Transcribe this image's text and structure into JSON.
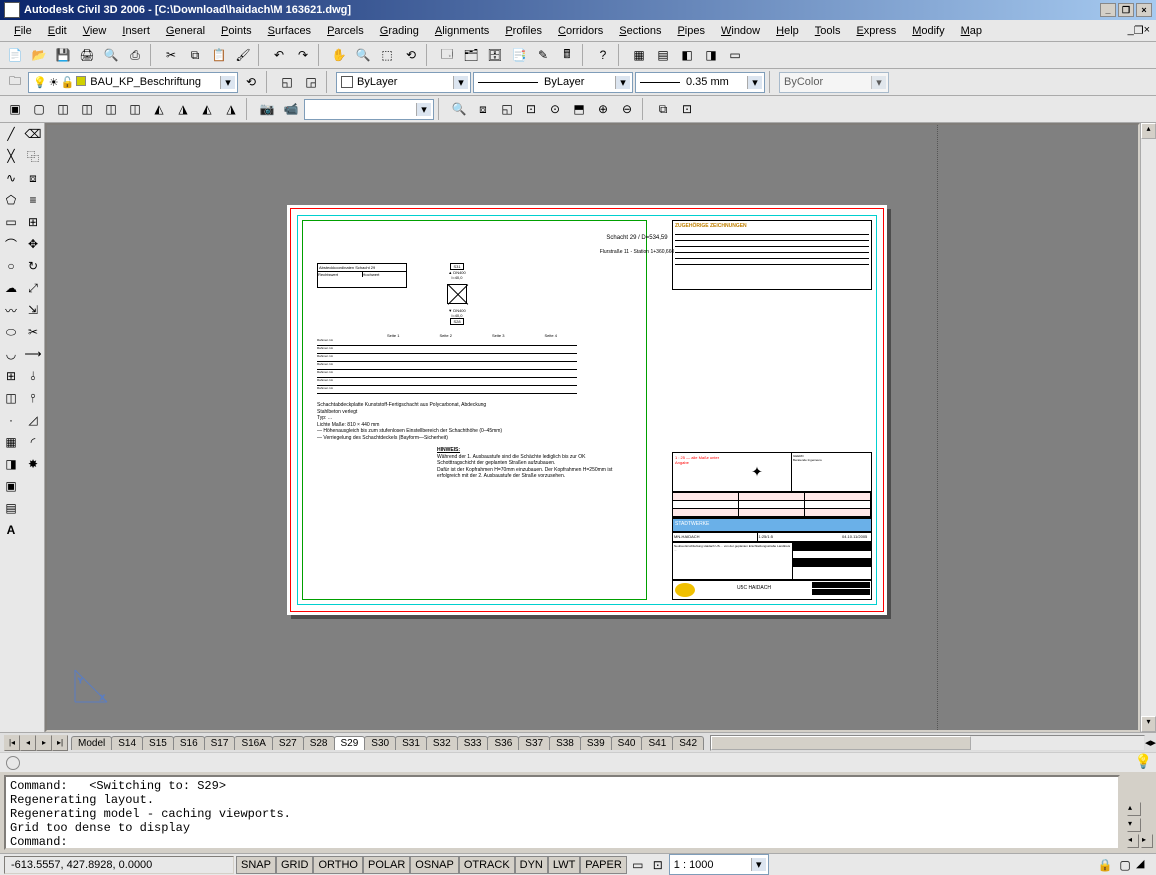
{
  "title": "Autodesk Civil 3D 2006 - [C:\\Download\\haidach\\M 163621.dwg]",
  "menus": [
    "File",
    "Edit",
    "View",
    "Insert",
    "General",
    "Points",
    "Surfaces",
    "Parcels",
    "Grading",
    "Alignments",
    "Profiles",
    "Corridors",
    "Sections",
    "Pipes",
    "Window",
    "Help",
    "Tools",
    "Express",
    "Modify",
    "Map"
  ],
  "layer": {
    "current": "BAU_KP_Beschriftung"
  },
  "props": {
    "color": "ByLayer",
    "linetype": "ByLayer",
    "lineweight": "0.35 mm",
    "plotstyle": "ByColor"
  },
  "tabs": [
    "Model",
    "S14",
    "S15",
    "S16",
    "S17",
    "S16A",
    "S27",
    "S28",
    "S29",
    "S30",
    "S31",
    "S32",
    "S33",
    "S36",
    "S37",
    "S38",
    "S39",
    "S40",
    "S41",
    "S42"
  ],
  "active_tab": "S29",
  "command_lines": [
    "Command:   <Switching to: S29>",
    "Regenerating layout.",
    "Regenerating model - caching viewports.",
    "Grid too dense to display",
    "Command:"
  ],
  "status": {
    "coords": "-613.5557, 427.8928, 0.0000",
    "buttons": [
      "SNAP",
      "GRID",
      "ORTHO",
      "POLAR",
      "OSNAP",
      "OTRACK",
      "DYN",
      "LWT",
      "PAPER"
    ],
    "scale": "1 : 1000"
  },
  "drawing": {
    "title1": "Schacht 29 / D=534,59",
    "title2": "Flurstraße 11 - Station 1+360,660",
    "titleblock_header": "ZUGEHÖRIGE ZEICHNUNGEN",
    "project": "U5C HAIDACH",
    "note": "HINWEIS:",
    "notetext": "Während der 1. Ausbaustufe sind die Schächte lediglich bis zur OK Schotttragschicht der geplanten Straßen aufzubauen.",
    "notetext2": "Dafür ist der Kopfrahmen H=70mm einzubauen. Der Kopfrahmen H=250mm ist erfolgreich mit der 2. Ausbaustufe der Straße vorzusehen."
  }
}
